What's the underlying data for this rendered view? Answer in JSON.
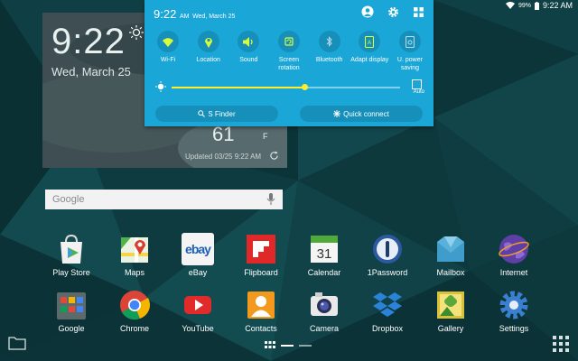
{
  "status_bar": {
    "battery_pct": "99%",
    "time": "9:22 AM"
  },
  "clock_widget": {
    "time": "9:22",
    "date": "Wed, March 25",
    "temperature": "61",
    "unit": "F",
    "updated": "Updated 03/25 9:22 AM"
  },
  "panel": {
    "time": "9:22",
    "ampm": "AM",
    "date": "Wed, March 25",
    "toggles": [
      {
        "label": "Wi-Fi",
        "icon": "wifi-icon"
      },
      {
        "label": "Location",
        "icon": "location-icon"
      },
      {
        "label": "Sound",
        "icon": "sound-icon"
      },
      {
        "label": "Screen rotation",
        "icon": "screen-rotation-icon"
      },
      {
        "label": "Bluetooth",
        "icon": "bluetooth-icon"
      },
      {
        "label": "Adapt display",
        "icon": "adapt-display-icon"
      },
      {
        "label": "U. power saving",
        "icon": "power-saving-icon"
      }
    ],
    "brightness_pct": 58,
    "auto_label": "Auto",
    "s_finder": "S Finder",
    "quick_connect": "Quick connect",
    "accent": "#1aa6d6"
  },
  "search": {
    "label": "Google"
  },
  "apps": {
    "row1": [
      {
        "label": "Play Store",
        "icon": "play-store-icon"
      },
      {
        "label": "Maps",
        "icon": "maps-icon"
      },
      {
        "label": "eBay",
        "icon": "ebay-icon"
      },
      {
        "label": "Flipboard",
        "icon": "flipboard-icon"
      },
      {
        "label": "Calendar",
        "icon": "calendar-icon",
        "day": "31"
      },
      {
        "label": "1Password",
        "icon": "1password-icon"
      },
      {
        "label": "Mailbox",
        "icon": "mailbox-icon"
      },
      {
        "label": "Internet",
        "icon": "internet-icon"
      }
    ],
    "row2": [
      {
        "label": "Google",
        "icon": "google-folder-icon"
      },
      {
        "label": "Chrome",
        "icon": "chrome-icon"
      },
      {
        "label": "YouTube",
        "icon": "youtube-icon"
      },
      {
        "label": "Contacts",
        "icon": "contacts-icon"
      },
      {
        "label": "Camera",
        "icon": "camera-icon"
      },
      {
        "label": "Dropbox",
        "icon": "dropbox-icon"
      },
      {
        "label": "Gallery",
        "icon": "gallery-icon"
      },
      {
        "label": "Settings",
        "icon": "settings-icon"
      }
    ]
  },
  "ebay_text": "ebay"
}
